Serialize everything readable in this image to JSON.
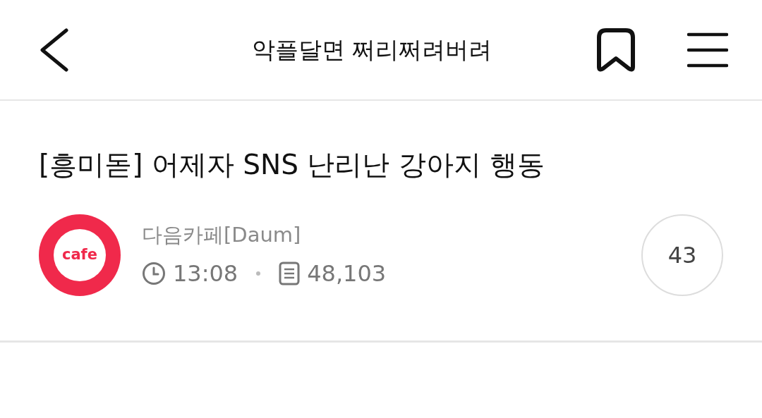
{
  "header": {
    "title": "악플달면 쩌리쩌려버려"
  },
  "post": {
    "title": "[흥미돋] 어제자 SNS 난리난 강아지 행동",
    "source": {
      "logo_text": "cafe",
      "name": "다음카페[Daum]"
    },
    "time": "13:08",
    "views": "48,103",
    "comments": "43"
  }
}
